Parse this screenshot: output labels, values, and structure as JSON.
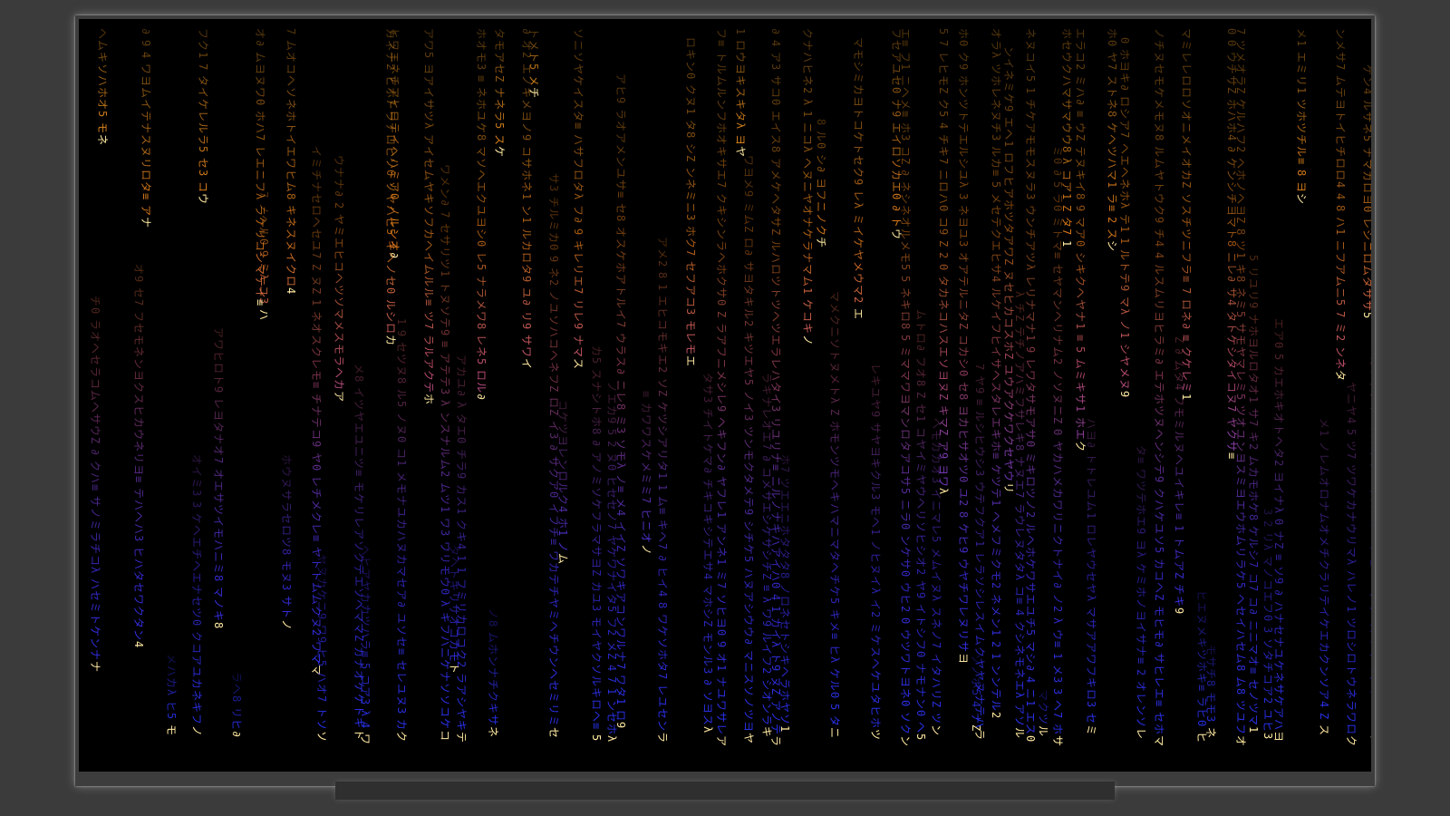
{
  "window": {
    "content": "digital-rain-animation"
  },
  "palette": {
    "frame": "#3d3d3d",
    "background": "#3b3b3b",
    "screen": "#000000",
    "gradient_top": "#e08a1e",
    "gradient_mid": "#8a3fb0",
    "gradient_bottom": "#2f2fe0",
    "head_glow": "#ffe9a0"
  },
  "glyph_icon": "digital-rain-glyph"
}
